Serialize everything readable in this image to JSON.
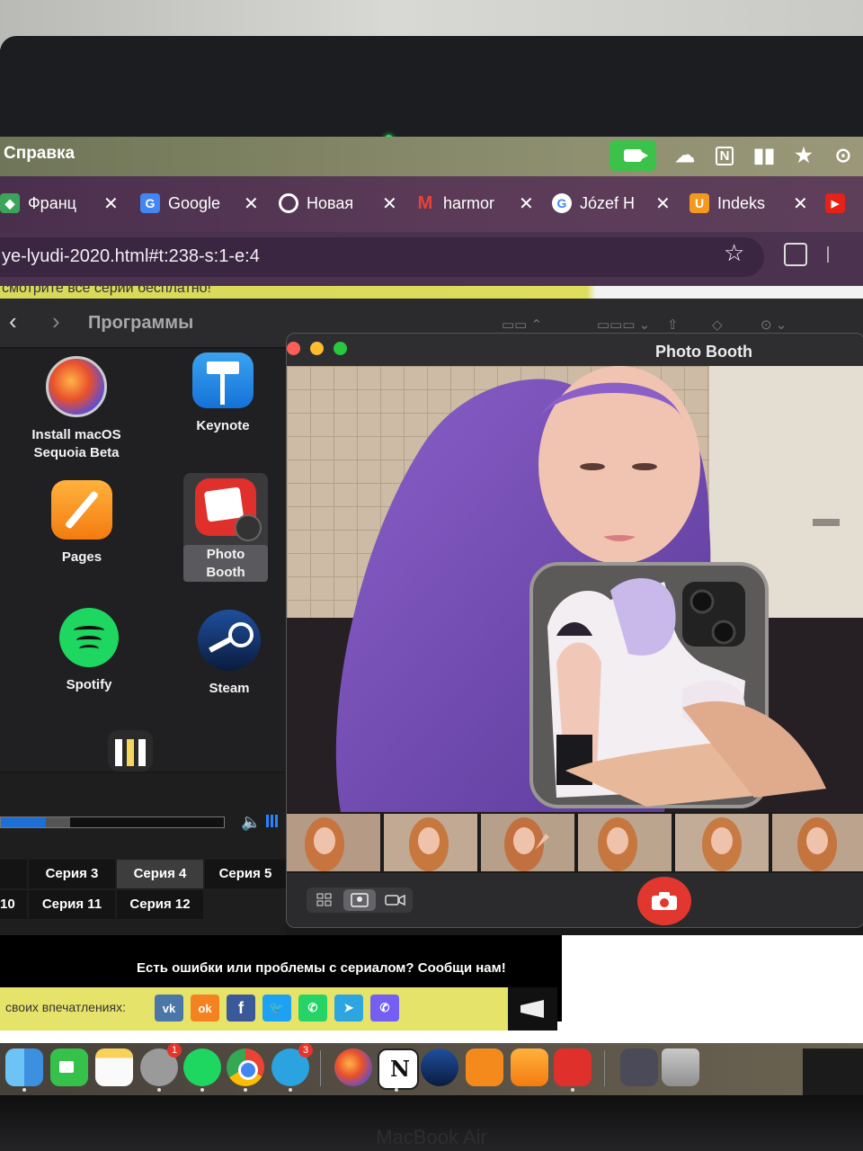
{
  "menubar": {
    "menu_item": "Справка",
    "status_icons": [
      "facetime-camera-icon",
      "creative-cloud-icon",
      "notion-icon",
      "bars-icon",
      "star-icon",
      "play-icon"
    ]
  },
  "browser": {
    "tabs": [
      {
        "title": "Франц",
        "icon": "cube-icon"
      },
      {
        "title": "Google",
        "icon": "google-translate-icon"
      },
      {
        "title": "Новая",
        "icon": "opera-icon"
      },
      {
        "title": "harmor",
        "icon": "gmail-icon"
      },
      {
        "title": "Józef H",
        "icon": "google-icon"
      },
      {
        "title": "Indeks",
        "icon": "u-icon"
      }
    ],
    "close_glyph": "✕",
    "url": "ye-lyudi-2020.html#t:238-s:1-e:4",
    "banner": "смотрите все серии бесплатно!"
  },
  "launchpad": {
    "folder": "Программы",
    "apps": [
      {
        "label": "Install macOS\nSequoia Beta",
        "icon": "macos-installer-icon"
      },
      {
        "label": "Keynote",
        "icon": "keynote-icon"
      },
      {
        "label": "Pages",
        "icon": "pages-icon"
      },
      {
        "label": "Photo Booth",
        "icon": "photo-booth-icon",
        "selected": true
      },
      {
        "label": "Spotify",
        "icon": "spotify-icon"
      },
      {
        "label": "Steam",
        "icon": "steam-icon"
      }
    ]
  },
  "player": {
    "played_fraction": 0.2,
    "buffered_fraction": 0.31,
    "episodes_row1": [
      "Серия 3",
      "Серия 4",
      "Серия 5"
    ],
    "episodes_row2": [
      "Серия 11",
      "Серия 12"
    ],
    "partial_row2": "10",
    "active_episode": "Серия 4"
  },
  "page": {
    "report_text": "Есть ошибки или проблемы с сериалом? Сообщи нам!",
    "share_label": "своих впечатлениях:",
    "share_buttons": [
      "vk",
      "ok",
      "f",
      "twitter",
      "whatsapp",
      "telegram",
      "viber"
    ]
  },
  "photobooth": {
    "title": "Photo Booth",
    "thumbnail_count": 6,
    "view_modes": [
      "grid-view-icon",
      "single-view-icon",
      "video-icon"
    ]
  },
  "dock": {
    "apps": [
      "finder-icon",
      "facetime-icon",
      "notes-icon",
      "system-settings-icon",
      "spotify-icon",
      "chrome-icon",
      "telegram-icon",
      "macos-installer-icon",
      "notion-icon",
      "steam-icon",
      "books-icon",
      "pages-icon",
      "photo-booth-icon",
      "downloads-icon",
      "trash-icon"
    ],
    "badges": {
      "system_settings": "1",
      "telegram": "3"
    }
  },
  "hardware": {
    "brand": "MacBook Air"
  }
}
